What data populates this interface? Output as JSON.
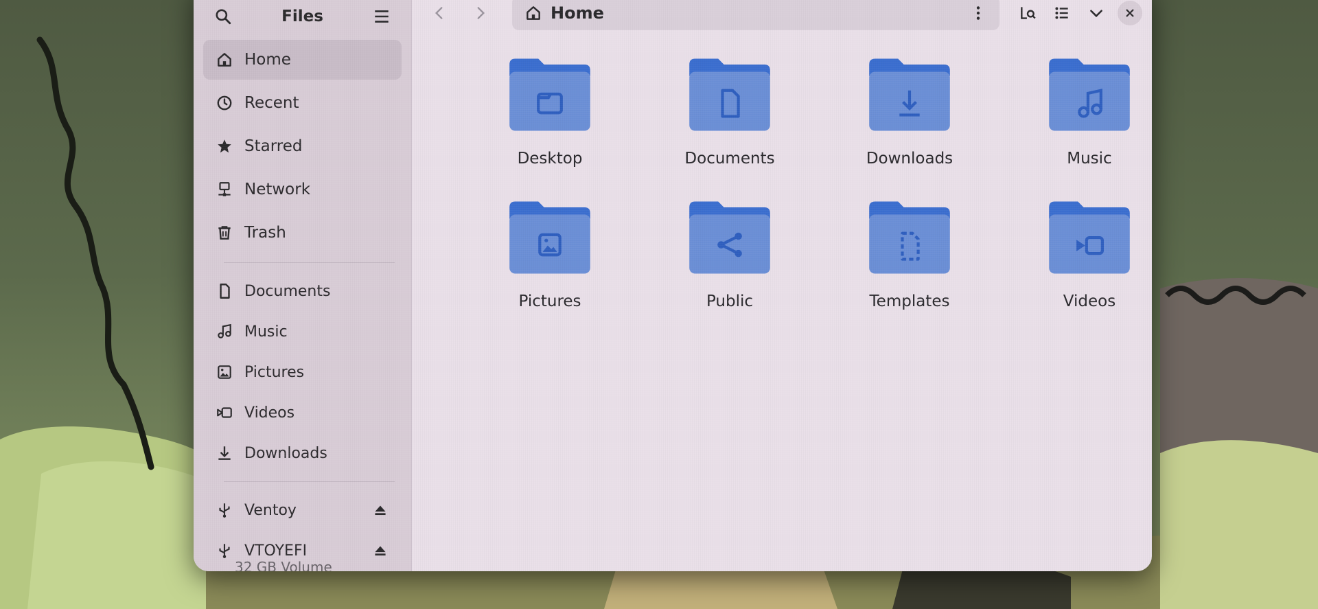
{
  "window": {
    "title": "Files",
    "path": "Home"
  },
  "sidebar": {
    "places": [
      {
        "label": "Home",
        "icon": "home-icon",
        "active": true
      },
      {
        "label": "Recent",
        "icon": "clock-icon"
      },
      {
        "label": "Starred",
        "icon": "star-icon"
      },
      {
        "label": "Network",
        "icon": "network-icon"
      },
      {
        "label": "Trash",
        "icon": "trash-icon"
      }
    ],
    "bookmarks": [
      {
        "label": "Documents",
        "icon": "document-icon"
      },
      {
        "label": "Music",
        "icon": "music-icon"
      },
      {
        "label": "Pictures",
        "icon": "picture-icon"
      },
      {
        "label": "Videos",
        "icon": "video-icon"
      },
      {
        "label": "Downloads",
        "icon": "download-icon"
      }
    ],
    "devices": [
      {
        "label": "Ventoy",
        "icon": "usb-icon",
        "eject": true
      },
      {
        "label": "VTOYEFI",
        "icon": "usb-icon",
        "eject": true
      }
    ],
    "cut_off_label": "32 GB Volume"
  },
  "folders": [
    {
      "label": "Desktop",
      "icon": "desktop-folder-icon"
    },
    {
      "label": "Documents",
      "icon": "documents-folder-icon"
    },
    {
      "label": "Downloads",
      "icon": "downloads-folder-icon"
    },
    {
      "label": "Music",
      "icon": "music-folder-icon"
    },
    {
      "label": "Pictures",
      "icon": "pictures-folder-icon"
    },
    {
      "label": "Public",
      "icon": "public-folder-icon"
    },
    {
      "label": "Templates",
      "icon": "templates-folder-icon"
    },
    {
      "label": "Videos",
      "icon": "videos-folder-icon"
    }
  ],
  "colors": {
    "folder_dark": "#3b6ecf",
    "folder_light": "#6b8fd6",
    "window_bg": "#e9dfe8",
    "sidebar_bg": "#d8ccd6"
  }
}
